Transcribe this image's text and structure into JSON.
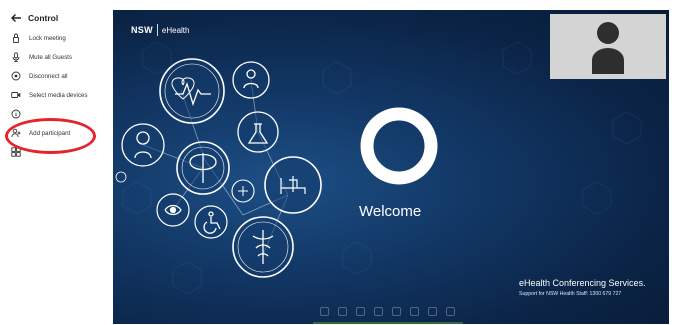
{
  "sidebar": {
    "title": "Control",
    "items": [
      {
        "label": "Lock meeting",
        "icon": "lock-icon"
      },
      {
        "label": "Mute all Guests",
        "icon": "mic-icon"
      },
      {
        "label": "Disconnect all",
        "icon": "disconnect-icon"
      },
      {
        "label": "Select media devices",
        "icon": "camera-icon"
      },
      {
        "label": "",
        "icon": "info-icon"
      },
      {
        "label": "Add participant",
        "icon": "add-person-icon"
      },
      {
        "label": "",
        "icon": "layout-icon"
      }
    ]
  },
  "stage": {
    "brand_nsw": "NSW",
    "brand_ehealth": "eHealth",
    "welcome": "Welcome",
    "conference_title": "eHealth Conferencing Services.",
    "support_line": "Support for NSW Health Staff: 1300 679 727"
  },
  "colors": {
    "highlight": "#e3262b",
    "background": "#0b2447",
    "accent": "#1d4f86"
  }
}
